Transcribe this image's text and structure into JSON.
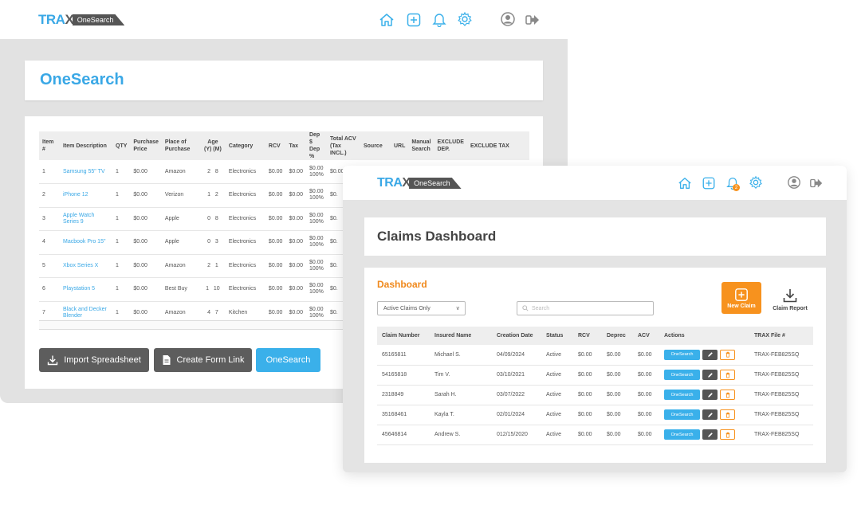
{
  "brand": {
    "logo_main": "TRA",
    "logo_x": "X",
    "logo_tab": "OneSearch"
  },
  "colors": {
    "accent_blue": "#3ab0ea",
    "accent_orange": "#f7921e",
    "dark_button": "#5d5d5d"
  },
  "icons": [
    "home-icon",
    "plus-square-icon",
    "bell-icon",
    "gear-icon",
    "user-circle-icon",
    "logout-icon",
    "download-icon",
    "file-icon",
    "search-icon",
    "pencil-icon",
    "trash-icon"
  ],
  "back_window": {
    "page_title": "OneSearch",
    "table_headers": {
      "item": "Item #",
      "description": "Item Description",
      "qty": "QTY",
      "purchase_price": "Purchase Price",
      "place": "Place of Purchase",
      "age": "Age",
      "age_sub": "(Y) (M)",
      "category": "Category",
      "rcv": "RCV",
      "tax": "Tax",
      "dep": "Dep $ Dep %",
      "total_acv": "Total ACV (Tax INCL.)",
      "source": "Source",
      "url": "URL",
      "manual_search": "Manual Search",
      "exclude_dep": "EXCLUDE DEP.",
      "exclude_tax": "EXCLUDE TAX"
    },
    "items": [
      {
        "num": "1",
        "desc": "Samsung 55\" TV",
        "qty": "1",
        "price": "$0.00",
        "place": "Amazon",
        "age_y": "2",
        "age_m": "8",
        "category": "Electronics",
        "rcv": "$0.00",
        "tax": "$0.00",
        "dep_amt": "$0.00",
        "dep_pct": "100%",
        "acv": "$0.00"
      },
      {
        "num": "2",
        "desc": "iPhone 12",
        "qty": "1",
        "price": "$0.00",
        "place": "Verizon",
        "age_y": "1",
        "age_m": "2",
        "category": "Electronics",
        "rcv": "$0.00",
        "tax": "$0.00",
        "dep_amt": "$0.00",
        "dep_pct": "100%",
        "acv": "$0."
      },
      {
        "num": "3",
        "desc": "Apple Watch Series 9",
        "qty": "1",
        "price": "$0.00",
        "place": "Apple",
        "age_y": "0",
        "age_m": "8",
        "category": "Electronics",
        "rcv": "$0.00",
        "tax": "$0.00",
        "dep_amt": "$0.00",
        "dep_pct": "100%",
        "acv": "$0."
      },
      {
        "num": "4",
        "desc": "Macbook Pro 15\"",
        "qty": "1",
        "price": "$0.00",
        "place": "Apple",
        "age_y": "0",
        "age_m": "3",
        "category": "Electronics",
        "rcv": "$0.00",
        "tax": "$0.00",
        "dep_amt": "$0.00",
        "dep_pct": "100%",
        "acv": "$0."
      },
      {
        "num": "5",
        "desc": "Xbox Series X",
        "qty": "1",
        "price": "$0.00",
        "place": "Amazon",
        "age_y": "2",
        "age_m": "1",
        "category": "Electronics",
        "rcv": "$0.00",
        "tax": "$0.00",
        "dep_amt": "$0.00",
        "dep_pct": "100%",
        "acv": "$0."
      },
      {
        "num": "6",
        "desc": "Playstation 5",
        "qty": "1",
        "price": "$0.00",
        "place": "Best Buy",
        "age_y": "1",
        "age_m": "10",
        "category": "Electronics",
        "rcv": "$0.00",
        "tax": "$0.00",
        "dep_amt": "$0.00",
        "dep_pct": "100%",
        "acv": "$0."
      },
      {
        "num": "7",
        "desc": "Black and Decker Blender",
        "qty": "1",
        "price": "$0.00",
        "place": "Amazon",
        "age_y": "4",
        "age_m": "7",
        "category": "Kitchen",
        "rcv": "$0.00",
        "tax": "$0.00",
        "dep_amt": "$0.00",
        "dep_pct": "100%",
        "acv": "$0."
      }
    ],
    "buttons": {
      "import": "Import Spreadsheet",
      "create_form": "Create Form Link",
      "onesearch": "OneSearch"
    }
  },
  "front_window": {
    "page_title": "Claims Dashboard",
    "section_title": "Dashboard",
    "notification_count": "2",
    "filter": {
      "selected": "Active Claims Only",
      "caret": "v"
    },
    "search": {
      "placeholder": "Search"
    },
    "buttons": {
      "new_claim": "New Claim",
      "claim_report": "Claim Report"
    },
    "table_headers": {
      "claim_number": "Claim Number",
      "insured_name": "Insured Name",
      "creation_date": "Creation Date",
      "status": "Status",
      "rcv": "RCV",
      "deprec": "Deprec",
      "acv": "ACV",
      "actions": "Actions",
      "trax_file": "TRAX File #"
    },
    "action_label": "OneSearch",
    "claims": [
      {
        "number": "65165811",
        "name": "Michael S.",
        "date": "04/09/2024",
        "status": "Active",
        "rcv": "$0.00",
        "deprec": "$0.00",
        "acv": "$0.00",
        "file": "TRAX-FEB825SQ"
      },
      {
        "number": "54165818",
        "name": "Tim V.",
        "date": "03/10/2021",
        "status": "Active",
        "rcv": "$0.00",
        "deprec": "$0.00",
        "acv": "$0.00",
        "file": "TRAX-FEB825SQ"
      },
      {
        "number": "2318849",
        "name": "Sarah H.",
        "date": "03/07/2022",
        "status": "Active",
        "rcv": "$0.00",
        "deprec": "$0.00",
        "acv": "$0.00",
        "file": "TRAX-FEB825SQ"
      },
      {
        "number": "35168461",
        "name": "Kayla T.",
        "date": "02/01/2024",
        "status": "Active",
        "rcv": "$0.00",
        "deprec": "$0.00",
        "acv": "$0.00",
        "file": "TRAX-FEB825SQ"
      },
      {
        "number": "45646814",
        "name": "Andrew S.",
        "date": "012/15/2020",
        "status": "Active",
        "rcv": "$0.00",
        "deprec": "$0.00",
        "acv": "$0.00",
        "file": "TRAX-FEB825SQ"
      }
    ]
  }
}
